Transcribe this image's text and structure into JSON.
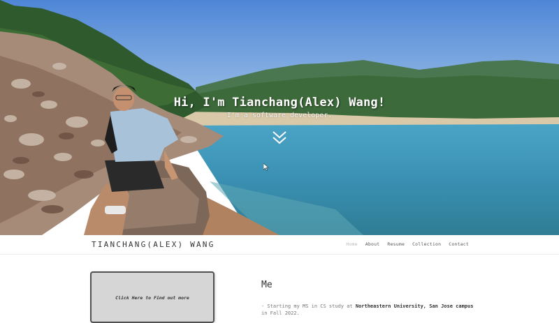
{
  "hero": {
    "title": "Hi, I'm Tianchang(Alex) Wang!",
    "subtitle": "I'm a software developer.",
    "scroll_icon": "double-chevron-down-icon"
  },
  "navbar": {
    "brand": "TIANCHANG(ALEX) WANG",
    "links": [
      "Home",
      "About",
      "Resume",
      "Collection",
      "Contact"
    ],
    "active_index": 0
  },
  "about": {
    "card_label": "Click Here to Find out more",
    "heading": "Me",
    "intro_prefix": "- Starting my MS in CS study at ",
    "university": "Northeastern University, San Jose campus",
    "intro_suffix": " in Fall 2022."
  },
  "colors": {
    "sky": "#5a8fd8",
    "water": "#3f9cbc",
    "hills": "#3c6a3a",
    "nav_bg": "#ffffff",
    "card_bg": "#d6d6d6"
  }
}
